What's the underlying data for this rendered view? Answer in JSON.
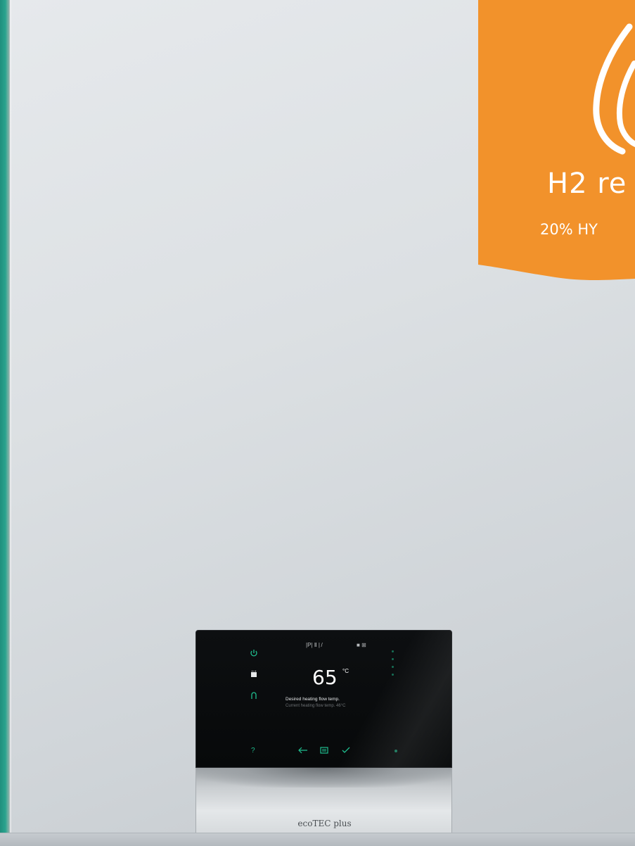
{
  "badge": {
    "title": "H2 re",
    "subtitle": "20% HY",
    "background_color": "#F2922B",
    "icon": "flame-icon"
  },
  "panel": {
    "status_icons": "|P| Ⅱ | / ",
    "status_right": "■ ⊞",
    "temperature_value": "65",
    "temperature_unit": "°C",
    "caption": "Desired heating flow temp.",
    "sub_caption": "Current heating flow temp. 46°C",
    "left_icons": [
      "power-icon",
      "hot-water-icon",
      "heating-icon",
      "help-icon"
    ],
    "nav_icons": [
      "back-icon",
      "menu-icon",
      "confirm-icon"
    ],
    "accent_color": "#1FBF8F"
  },
  "product": {
    "name": "ecoTEC plus"
  }
}
